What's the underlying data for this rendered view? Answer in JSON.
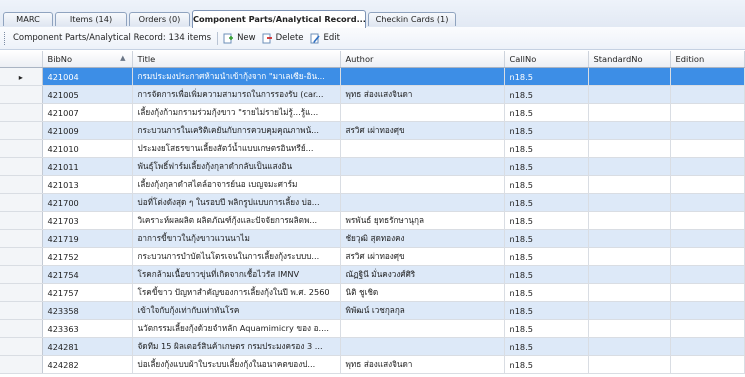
{
  "tabs": [
    {
      "label": "MARC"
    },
    {
      "label": "Items (14)"
    },
    {
      "label": "Orders (0)"
    },
    {
      "label": "Component Parts/Analytical Record..."
    },
    {
      "label": "Checkin Cards (1)"
    }
  ],
  "toolbar": {
    "summary": "Component Parts/Analytical Record: 134 items",
    "new_label": "New",
    "delete_label": "Delete",
    "edit_label": "Edit"
  },
  "grid": {
    "columns": [
      "BibNo",
      "Title",
      "Author",
      "CallNo",
      "StandardNo",
      "Edition"
    ],
    "sorted_column": "BibNo",
    "selected_index": 0,
    "rows": [
      {
        "bibno": "421004",
        "title": "กรมประมงประกาศห้ามนำเข้ากุ้งจาก \"มาเลเซีย-อิน...",
        "author": "",
        "callno": "n18.5",
        "standardno": "",
        "edition": ""
      },
      {
        "bibno": "421005",
        "title": "การจัดการเพื่อเพิ่มความสามารถในการรองรับ (car...",
        "author": "พุทธ ส่องแสงจินดา",
        "callno": "n18.5",
        "standardno": "",
        "edition": ""
      },
      {
        "bibno": "421007",
        "title": "เลี้ยงกุ้งก้ามกรามร่วมกุ้งขาว \"รายไม่รายไม่รู้...รู้แ...",
        "author": "",
        "callno": "n18.5",
        "standardno": "",
        "edition": ""
      },
      {
        "bibno": "421009",
        "title": "กระบวนการในเคริติเคยันกับการควบคุมคุณภาพน้...",
        "author": "สรวิศ เผ่าทองศุข",
        "callno": "n18.5",
        "standardno": "",
        "edition": ""
      },
      {
        "bibno": "421010",
        "title": "ประมงยโสธรขานเลี้ยงสัตว์น้ำแบบเกษตรอินทรีย์...",
        "author": "",
        "callno": "n18.5",
        "standardno": "",
        "edition": ""
      },
      {
        "bibno": "421011",
        "title": "พันธุ์โพธิ์ฟาร์มเลี้ยงกุ้งกุลาดำกลับเป็นแสงอิน",
        "author": "",
        "callno": "n18.5",
        "standardno": "",
        "edition": ""
      },
      {
        "bibno": "421013",
        "title": "เลี้ยงกุ้งกุลาดำสไตล์อาจารย์นอ เบญจมะศาร์ม",
        "author": "",
        "callno": "n18.5",
        "standardno": "",
        "edition": ""
      },
      {
        "bibno": "421700",
        "title": "บ่อที่โต่งดังสุด ๆ ในรอบปี พลิกรูปแบบการเลี้ยง บ่อ...",
        "author": "",
        "callno": "n18.5",
        "standardno": "",
        "edition": ""
      },
      {
        "bibno": "421703",
        "title": "วิเคราะห์ผลผลิต ผลิตภัณฑ์กุ้งและปัจจัยการผลิตพ...",
        "author": "พรพันธ์ ยุทธรักษานุกุล",
        "callno": "n18.5",
        "standardno": "",
        "edition": ""
      },
      {
        "bibno": "421719",
        "title": "อาการขี้ขาวในกุ้งขาวแวนนาไม",
        "author": "ชัยวุฒิ สุดทองคง",
        "callno": "n18.5",
        "standardno": "",
        "edition": ""
      },
      {
        "bibno": "421752",
        "title": "กระบวนการบำบัดไนโตรเจนในการเลี้ยงกุ้งระบบบ...",
        "author": "สรวิศ เผ่าทองศุข",
        "callno": "n18.5",
        "standardno": "",
        "edition": ""
      },
      {
        "bibno": "421754",
        "title": "โรคกล้ามเนื้อขาวขุ่นที่เกิดจากเชื้อไวรัส IMNV",
        "author": "ณัฏฐินี มั่นคงวงศ์ศิริ",
        "callno": "n18.5",
        "standardno": "",
        "edition": ""
      },
      {
        "bibno": "421757",
        "title": "โรคขี้ขาว ปัญหาสำคัญของการเลี้ยงกุ้งในปี พ.ศ. 2560",
        "author": "นิติ ชูเชิด",
        "callno": "n18.5",
        "standardno": "",
        "edition": ""
      },
      {
        "bibno": "423358",
        "title": "เข้าใจกับกุ้งเท่ากับเท่าทันโรค",
        "author": "พิพัฒน์ เวชกุลกุล",
        "callno": "n18.5",
        "standardno": "",
        "edition": ""
      },
      {
        "bibno": "423363",
        "title": "นวัตกรรมเลี้ยงกุ้งด้วยจำหลัก Aquamimicry ของ อ....",
        "author": "",
        "callno": "n18.5",
        "standardno": "",
        "edition": ""
      },
      {
        "bibno": "424281",
        "title": "จัดทีม 15 ผิลเตอร์สินค้าเกษตร กรมประมงครอง 3 ...",
        "author": "",
        "callno": "n18.5",
        "standardno": "",
        "edition": ""
      },
      {
        "bibno": "424282",
        "title": "บ่อเลี้ยงกุ้งแบบผ้าใบระบบเลี้ยงกุ้งในอนาคตของป...",
        "author": "พุทธ ส่องแสงจินดา",
        "callno": "n18.5",
        "standardno": "",
        "edition": ""
      }
    ]
  },
  "icons": {
    "new": "new-icon",
    "delete": "delete-icon",
    "edit": "edit-icon",
    "row_pointer": "row-pointer-icon"
  },
  "colors": {
    "selection": "#3d8ee6",
    "alt_row": "#dde9f8",
    "tab_border": "#8fa3bf"
  }
}
